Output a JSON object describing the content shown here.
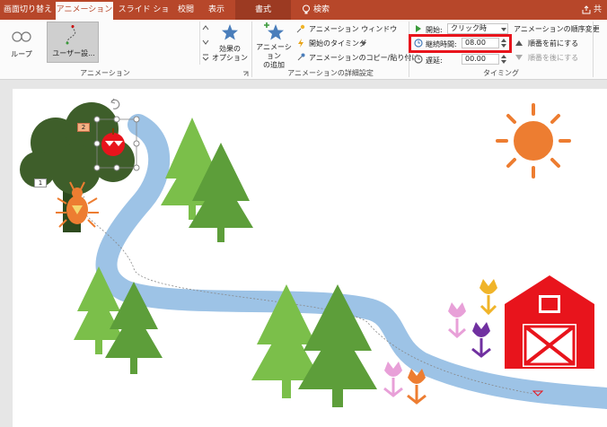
{
  "tabs": [
    "画面切り替え",
    "アニメーション",
    "スライド ショー",
    "校閲",
    "表示",
    "書式",
    "検索",
    "共有"
  ],
  "active_tab": "アニメーション",
  "ribbon": {
    "animations": {
      "items": [
        "ループ",
        "ユーザー設..."
      ],
      "group_label": "アニメーション"
    },
    "effect_options": "効果の\nオプション",
    "advanced": {
      "add_animation": "アニメーション\nの追加",
      "animation_pane": "アニメーション ウィンドウ",
      "trigger": "開始のタイミング",
      "painter": "アニメーションのコピー/貼り付け",
      "group_label": "アニメーションの詳細設定"
    },
    "timing": {
      "start_label": "開始:",
      "start_value": "クリック時",
      "duration_label": "継続時間:",
      "duration_value": "08.00",
      "delay_label": "遅延:",
      "delay_value": "00.00",
      "reorder_title": "アニメーションの順序変更",
      "move_earlier": "順番を前にする",
      "move_later": "順番を後にする",
      "group_label": "タイミング"
    }
  },
  "slide": {
    "anim_tags": [
      "1",
      "2"
    ]
  },
  "colors": {
    "accent": "#b7472a",
    "highlight": "#e8141c",
    "tree_light": "#7bbf4a",
    "tree_dark": "#5d9e3a",
    "river": "#9dc3e6",
    "sun": "#ed7d31",
    "barn": "#e8141c"
  }
}
